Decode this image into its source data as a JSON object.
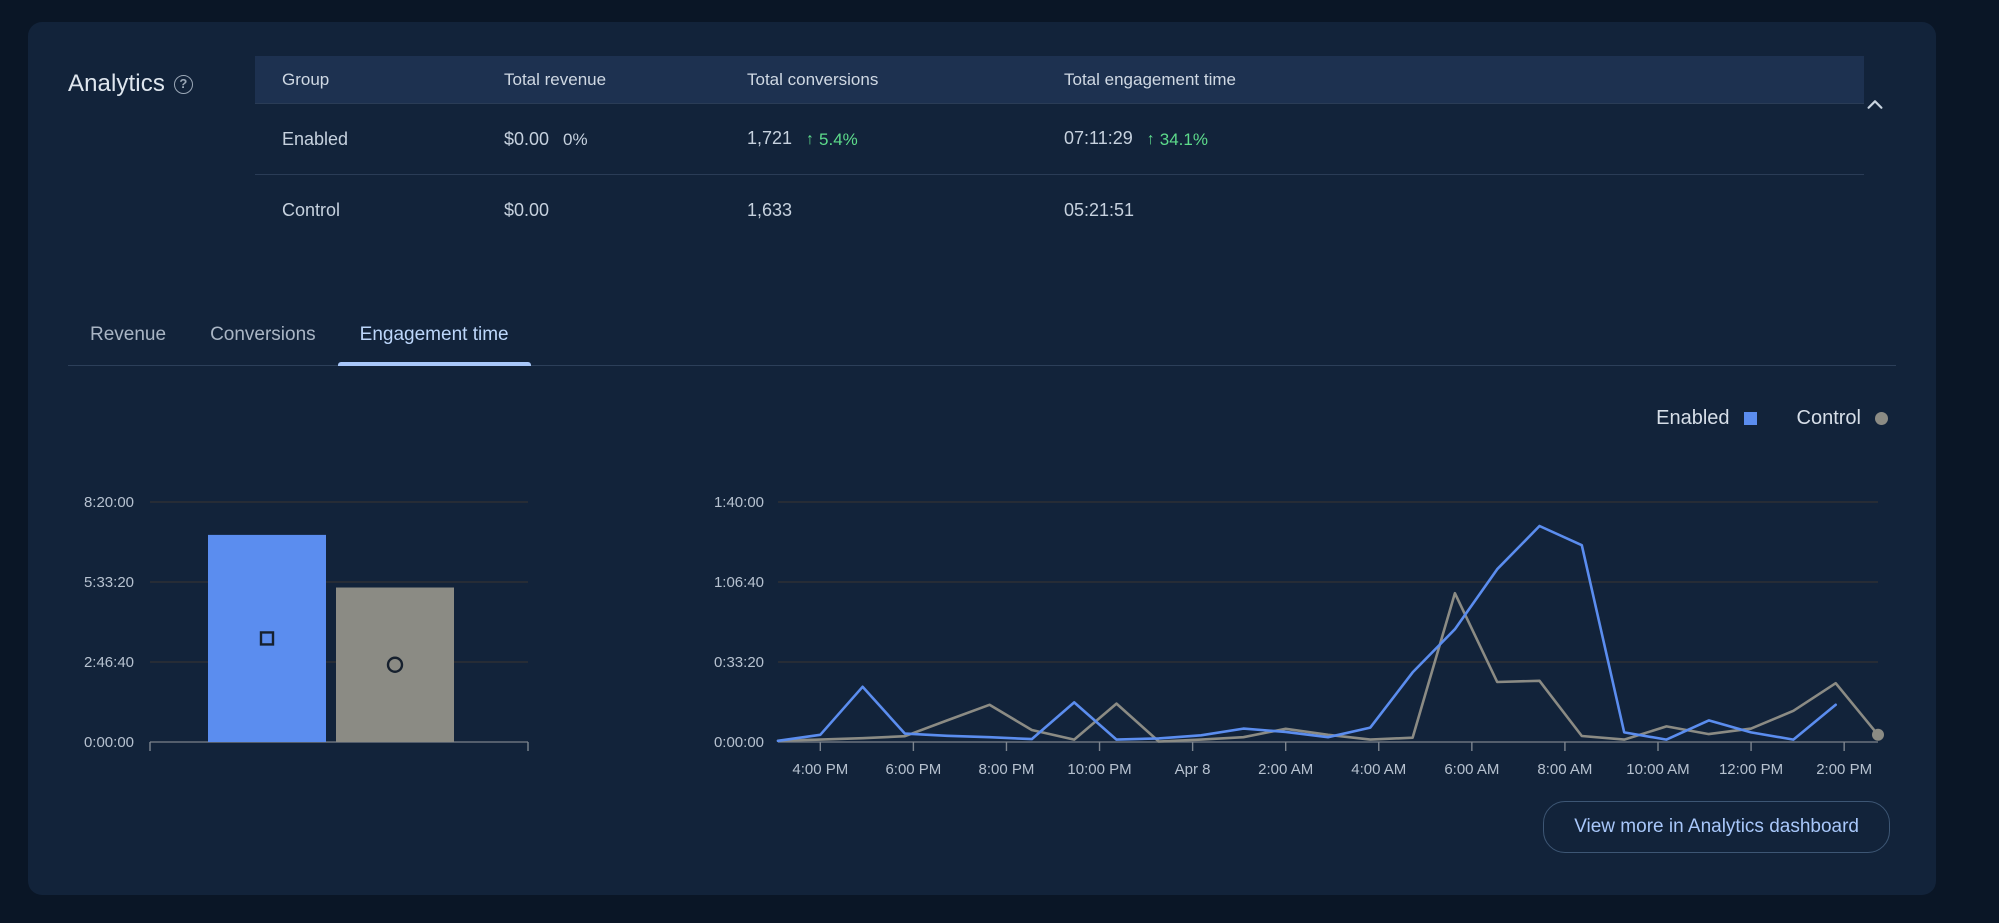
{
  "card": {
    "title": "Analytics",
    "help_icon": "help-circle-icon",
    "collapse_icon": "chevron-up-icon"
  },
  "table": {
    "columns": [
      "Group",
      "Total revenue",
      "Total conversions",
      "Total engagement time"
    ],
    "rows": [
      {
        "group": "Enabled",
        "revenue": "$0.00",
        "revenue_delta": "0%",
        "conversions": "1,721",
        "conversions_delta": "5.4%",
        "conversions_delta_arrow": "↑",
        "engagement": "07:11:29",
        "engagement_delta": "34.1%",
        "engagement_delta_arrow": "↑"
      },
      {
        "group": "Control",
        "revenue": "$0.00",
        "revenue_delta": "",
        "conversions": "1,633",
        "conversions_delta": "",
        "conversions_delta_arrow": "",
        "engagement": "05:21:51",
        "engagement_delta": "",
        "engagement_delta_arrow": ""
      }
    ]
  },
  "tabs": [
    {
      "label": "Revenue",
      "active": false
    },
    {
      "label": "Conversions",
      "active": false
    },
    {
      "label": "Engagement time",
      "active": true
    }
  ],
  "legend": [
    {
      "label": "Enabled",
      "marker": "square",
      "color": "#5b8def"
    },
    {
      "label": "Control",
      "marker": "circle",
      "color": "#8b8b84"
    }
  ],
  "footer": {
    "view_more_label": "View more in Analytics dashboard"
  },
  "colors": {
    "enabled": "#5b8def",
    "control": "#8b8b84",
    "positive": "#5ddb8b",
    "card_bg": "#12233a",
    "page_bg": "#0a1626",
    "accent": "#a8c7fa"
  },
  "chart_data": [
    {
      "type": "bar",
      "id": "engagement-average-bar",
      "title": "",
      "xlabel": "",
      "ylabel": "",
      "categories": [
        "Enabled",
        "Control"
      ],
      "values": [
        7.1914,
        5.3642
      ],
      "value_labels": [
        "07:11:29",
        "05:21:51"
      ],
      "ytick_labels": [
        "0:00:00",
        "2:46:40",
        "5:33:20",
        "8:20:00"
      ],
      "ytick_values": [
        0,
        2.7778,
        5.5556,
        8.3333
      ],
      "ylim": [
        0,
        8.3333
      ],
      "grid": true,
      "series": [
        {
          "name": "Enabled",
          "value": 7.1914,
          "color": "#5b8def",
          "marker": "square"
        },
        {
          "name": "Control",
          "value": 5.3642,
          "color": "#8b8b84",
          "marker": "circle"
        }
      ]
    },
    {
      "type": "line",
      "id": "engagement-time-series",
      "title": "",
      "xlabel": "",
      "ylabel": "",
      "xtick_labels": [
        "4:00 PM",
        "6:00 PM",
        "8:00 PM",
        "10:00 PM",
        "Apr 8",
        "2:00 AM",
        "4:00 AM",
        "6:00 AM",
        "8:00 AM",
        "10:00 AM",
        "12:00 PM",
        "2:00 PM"
      ],
      "ytick_labels": [
        "0:00:00",
        "0:33:20",
        "1:06:40",
        "1:40:00"
      ],
      "ytick_values": [
        0,
        33.333,
        66.667,
        100
      ],
      "ylim": [
        0,
        100
      ],
      "grid": true,
      "legend_position": "top-right",
      "x": [
        0,
        1,
        2,
        3,
        4,
        5,
        6,
        7,
        8,
        9,
        10,
        11,
        12,
        13,
        14,
        15,
        16,
        17,
        18,
        19,
        20,
        21,
        22,
        23,
        24,
        25
      ],
      "series": [
        {
          "name": "Enabled",
          "color": "#5b8def",
          "values": [
            0.5,
            3.0,
            23.0,
            3.5,
            2.6,
            2.0,
            1.2,
            16.5,
            1.0,
            1.5,
            2.8,
            5.6,
            4.2,
            2.0,
            6.0,
            29.0,
            47.0,
            72.0,
            90.0,
            82.0,
            4.0,
            1.0,
            9.0,
            4.0,
            1.0,
            15.5
          ]
        },
        {
          "name": "Control",
          "color": "#8b8b84",
          "values": [
            0.5,
            1.0,
            1.6,
            2.4,
            9.0,
            15.5,
            5.0,
            1.0,
            16.0,
            0.2,
            1.0,
            2.0,
            5.5,
            3.0,
            1.0,
            1.8,
            62.0,
            25.0,
            25.5,
            2.5,
            1.0,
            6.5,
            3.3,
            5.6,
            13.0,
            24.5,
            3.0
          ]
        }
      ]
    }
  ]
}
